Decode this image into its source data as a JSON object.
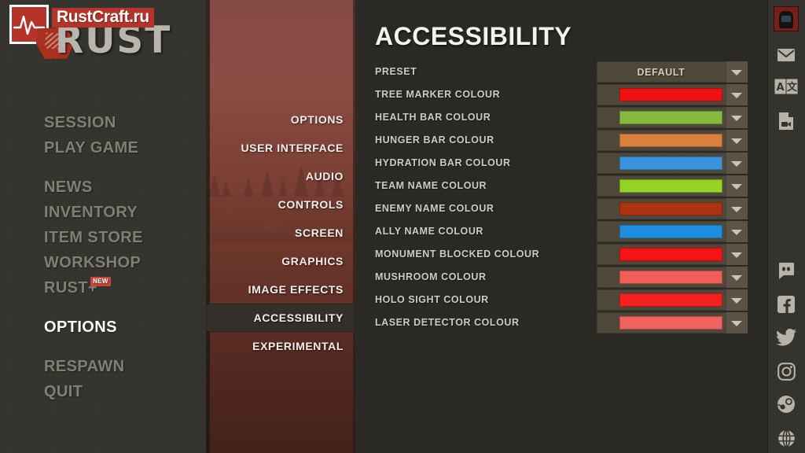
{
  "brand": {
    "watermark": "RustCraft.ru",
    "game_title": "RUST",
    "logo_icon": "heartbeat-icon",
    "splat_icon": "rust-splat-icon"
  },
  "main_menu": {
    "groups": [
      {
        "items": [
          {
            "label": "SESSION",
            "active": false
          },
          {
            "label": "PLAY GAME",
            "active": false
          }
        ]
      },
      {
        "items": [
          {
            "label": "NEWS",
            "active": false
          },
          {
            "label": "INVENTORY",
            "active": false
          },
          {
            "label": "ITEM STORE",
            "active": false
          },
          {
            "label": "WORKSHOP",
            "active": false
          },
          {
            "label": "RUST+",
            "active": false,
            "badge": "NEW"
          }
        ]
      },
      {
        "items": [
          {
            "label": "OPTIONS",
            "active": true
          }
        ]
      },
      {
        "items": [
          {
            "label": "RESPAWN",
            "active": false
          },
          {
            "label": "QUIT",
            "active": false
          }
        ]
      }
    ]
  },
  "options_nav": {
    "items": [
      {
        "label": "OPTIONS",
        "active": false
      },
      {
        "label": "USER INTERFACE",
        "active": false
      },
      {
        "label": "AUDIO",
        "active": false
      },
      {
        "label": "CONTROLS",
        "active": false
      },
      {
        "label": "SCREEN",
        "active": false
      },
      {
        "label": "GRAPHICS",
        "active": false
      },
      {
        "label": "IMAGE EFFECTS",
        "active": false
      },
      {
        "label": "ACCESSIBILITY",
        "active": true
      },
      {
        "label": "EXPERIMENTAL",
        "active": false
      }
    ]
  },
  "page": {
    "title": "ACCESSIBILITY"
  },
  "settings": [
    {
      "label": "PRESET",
      "type": "select",
      "value": "DEFAULT"
    },
    {
      "label": "TREE MARKER COLOUR",
      "type": "colour",
      "value": "#ee1111"
    },
    {
      "label": "HEALTH BAR COLOUR",
      "type": "colour",
      "value": "#84bb3c"
    },
    {
      "label": "HUNGER BAR COLOUR",
      "type": "colour",
      "value": "#d9803c"
    },
    {
      "label": "HYDRATION BAR COLOUR",
      "type": "colour",
      "value": "#3994dd"
    },
    {
      "label": "TEAM NAME COLOUR",
      "type": "colour",
      "value": "#96d226"
    },
    {
      "label": "ENEMY NAME COLOUR",
      "type": "colour",
      "value": "#ab330f"
    },
    {
      "label": "ALLY NAME COLOUR",
      "type": "colour",
      "value": "#1e8fe0"
    },
    {
      "label": "MONUMENT BLOCKED COLOUR",
      "type": "colour",
      "value": "#f41414"
    },
    {
      "label": "MUSHROOM COLOUR",
      "type": "colour",
      "value": "#f05e58"
    },
    {
      "label": "HOLO SIGHT COLOUR",
      "type": "colour",
      "value": "#f4211e"
    },
    {
      "label": "LASER DETECTOR COLOUR",
      "type": "colour",
      "value": "#f06260"
    }
  ],
  "right_rail": [
    {
      "name": "avatar",
      "label": "Player avatar"
    },
    {
      "name": "mail-icon",
      "label": "Messages"
    },
    {
      "name": "translate-icon",
      "label": "Language"
    },
    {
      "name": "video-file-icon",
      "label": "Demos"
    },
    {
      "name": "discord-icon",
      "label": "Discord"
    },
    {
      "name": "facebook-icon",
      "label": "Facebook"
    },
    {
      "name": "twitter-icon",
      "label": "Twitter"
    },
    {
      "name": "instagram-icon",
      "label": "Instagram"
    },
    {
      "name": "steam-icon",
      "label": "Steam"
    },
    {
      "name": "globe-icon",
      "label": "Website"
    }
  ],
  "colors": {
    "panel_dark": "#2a2926",
    "panel_left": "#35332d",
    "mid_tint": "#8a5149",
    "control_bg": "#4e483a",
    "control_arrow_bg": "#5b5446",
    "accent_red": "#b5342a",
    "text_dim": "#817e76",
    "text_bright": "#f5f2ec"
  }
}
